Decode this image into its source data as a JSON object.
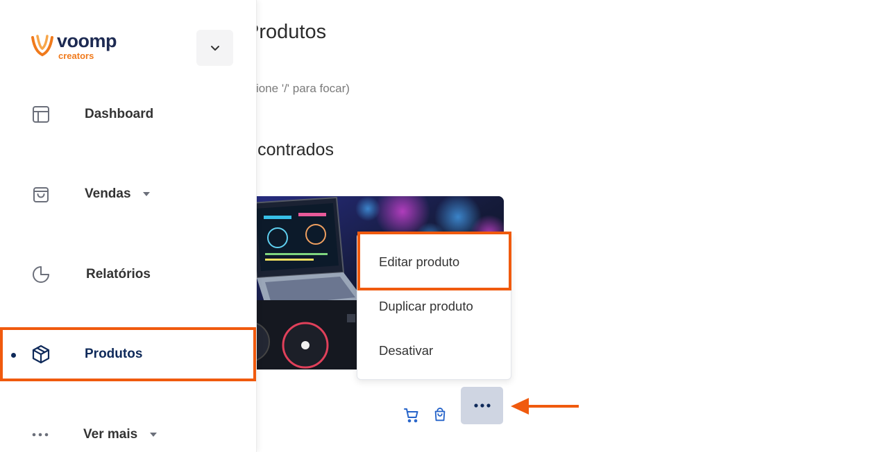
{
  "sidebar": {
    "logo": {
      "name": "voomp",
      "subtitle": "creators"
    },
    "items": [
      {
        "label": "Dashboard",
        "icon": "layout-icon"
      },
      {
        "label": "Vendas",
        "icon": "shopping-bag-icon",
        "has_dropdown": true
      },
      {
        "label": "Relatórios",
        "icon": "pie-chart-icon"
      },
      {
        "label": "Produtos",
        "icon": "package-icon",
        "active": true
      },
      {
        "label": "Ver mais",
        "icon": "more-horizontal-icon",
        "has_dropdown": true
      }
    ]
  },
  "main": {
    "title": "Produtos",
    "search": {
      "placeholder": "ar (Pressione '/' para focar)"
    },
    "results_label": "os encontrados",
    "product_card": {
      "actions": [
        "cart-icon",
        "shopping-bag-icon",
        "more-horizontal-icon"
      ]
    },
    "context_menu": {
      "items": [
        "Editar produto",
        "Duplicar produto",
        "Desativar"
      ]
    }
  },
  "colors": {
    "accent_orange": "#f05a0e",
    "brand_navy": "#0f2a5a",
    "more_button_bg": "#cfd5e2"
  }
}
